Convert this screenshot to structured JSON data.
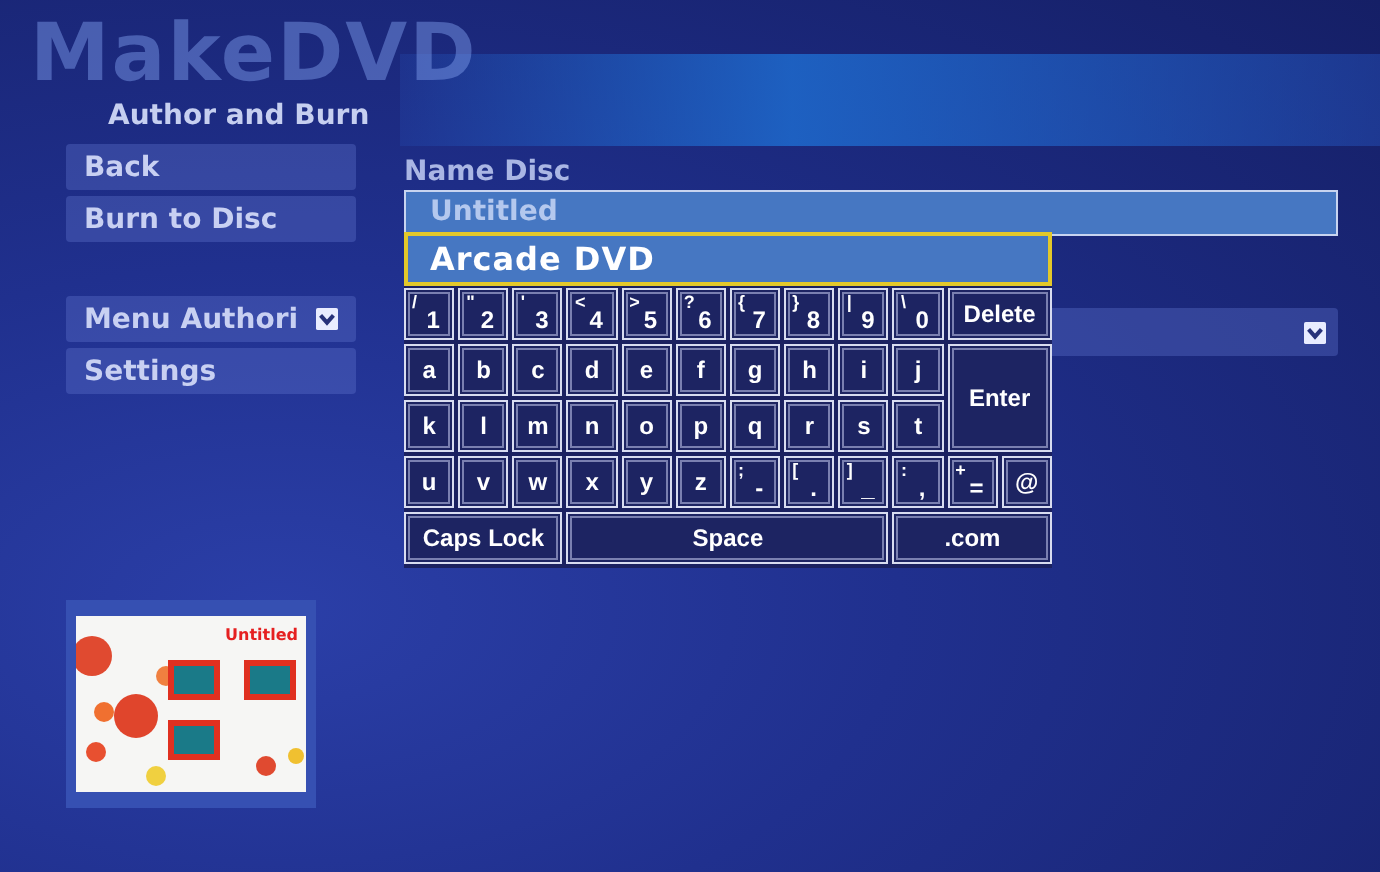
{
  "background_title": "MakeDVD",
  "sidebar": {
    "title": "Author and Burn",
    "items": [
      {
        "label": "Back",
        "kind": "button"
      },
      {
        "label": "Burn to Disc",
        "kind": "button"
      },
      {
        "label": "Menu Authori",
        "kind": "dropdown"
      },
      {
        "label": "Settings",
        "kind": "button"
      }
    ]
  },
  "name_disc": {
    "label": "Name Disc",
    "value": "Untitled",
    "suggestion": {
      "label": "Arcade DVD",
      "selected": true
    }
  },
  "keyboard": {
    "keys": [
      {
        "kind": "key",
        "shift": "/",
        "label": "1"
      },
      {
        "kind": "key",
        "shift": "\"",
        "label": "2"
      },
      {
        "kind": "key",
        "shift": "'",
        "label": "3"
      },
      {
        "kind": "key",
        "shift": "<",
        "label": "4"
      },
      {
        "kind": "key",
        "shift": ">",
        "label": "5"
      },
      {
        "kind": "key",
        "shift": "?",
        "label": "6"
      },
      {
        "kind": "key",
        "shift": "{",
        "label": "7"
      },
      {
        "kind": "key",
        "shift": "}",
        "label": "8"
      },
      {
        "kind": "key",
        "shift": "|",
        "label": "9"
      },
      {
        "kind": "key",
        "shift": "\\",
        "label": "0"
      },
      {
        "kind": "double",
        "label": "Delete"
      },
      {
        "kind": "key",
        "label": "a"
      },
      {
        "kind": "key",
        "label": "b"
      },
      {
        "kind": "key",
        "label": "c"
      },
      {
        "kind": "key",
        "label": "d"
      },
      {
        "kind": "key",
        "label": "e"
      },
      {
        "kind": "key",
        "label": "f"
      },
      {
        "kind": "key",
        "label": "g"
      },
      {
        "kind": "key",
        "label": "h"
      },
      {
        "kind": "key",
        "label": "i"
      },
      {
        "kind": "key",
        "label": "j"
      },
      {
        "kind": "tall",
        "label": "Enter"
      },
      {
        "kind": "key",
        "label": "k"
      },
      {
        "kind": "key",
        "label": "l"
      },
      {
        "kind": "key",
        "label": "m"
      },
      {
        "kind": "key",
        "label": "n"
      },
      {
        "kind": "key",
        "label": "o"
      },
      {
        "kind": "key",
        "label": "p"
      },
      {
        "kind": "key",
        "label": "q"
      },
      {
        "kind": "key",
        "label": "r"
      },
      {
        "kind": "key",
        "label": "s"
      },
      {
        "kind": "key",
        "label": "t"
      },
      {
        "kind": "key",
        "label": "u"
      },
      {
        "kind": "key",
        "label": "v"
      },
      {
        "kind": "key",
        "label": "w"
      },
      {
        "kind": "key",
        "label": "x"
      },
      {
        "kind": "key",
        "label": "y"
      },
      {
        "kind": "key",
        "label": "z"
      },
      {
        "kind": "key",
        "shift": ";",
        "label": "-"
      },
      {
        "kind": "key",
        "shift": "[",
        "label": "."
      },
      {
        "kind": "key",
        "shift": "]",
        "label": "_"
      },
      {
        "kind": "key",
        "shift": ":",
        "label": ","
      },
      {
        "kind": "key",
        "shift": "+",
        "label": "="
      },
      {
        "kind": "key",
        "label": "@"
      },
      {
        "kind": "triple",
        "label": "Caps Lock"
      },
      {
        "kind": "space",
        "label": "Space"
      },
      {
        "kind": "triple",
        "label": ".com"
      }
    ]
  },
  "preview": {
    "title": "Untitled"
  }
}
